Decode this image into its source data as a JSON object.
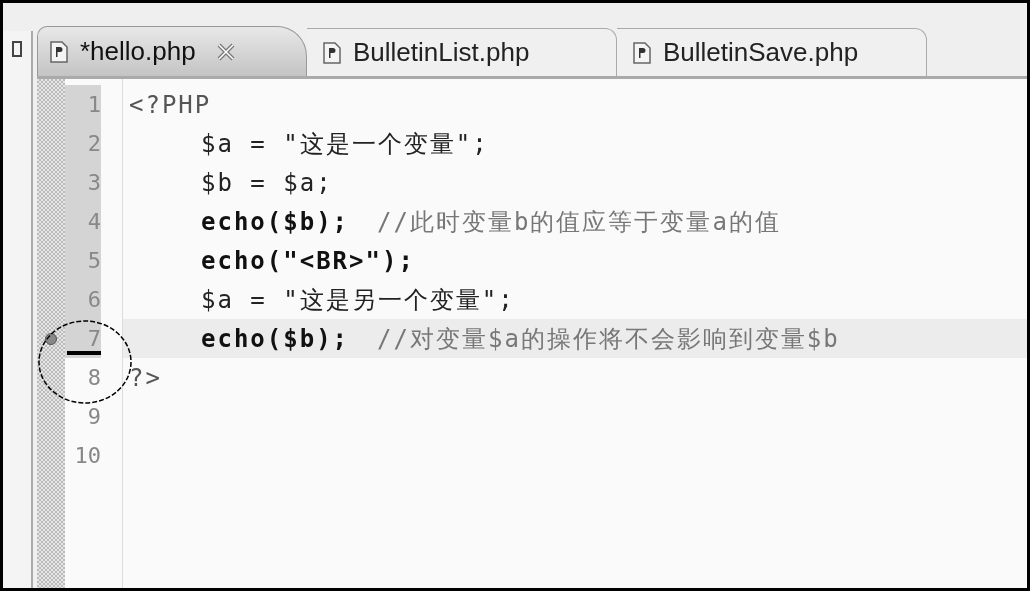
{
  "tabs": [
    {
      "label": "*hello.php",
      "selected": true
    },
    {
      "label": "BulletinList.php",
      "selected": false
    },
    {
      "label": "BulletinSave.php",
      "selected": false
    }
  ],
  "lines": [
    {
      "number": "1",
      "indented": false,
      "changed": true,
      "current": false,
      "marker": false,
      "segments": [
        {
          "kind": "tag",
          "text": "<?PHP"
        }
      ]
    },
    {
      "number": "2",
      "indented": true,
      "changed": true,
      "current": false,
      "marker": false,
      "segments": [
        {
          "kind": "plain",
          "text": "$a = \"这是一个变量\";"
        }
      ]
    },
    {
      "number": "3",
      "indented": true,
      "changed": true,
      "current": false,
      "marker": false,
      "segments": [
        {
          "kind": "plain",
          "text": "$b = $a;"
        }
      ]
    },
    {
      "number": "4",
      "indented": true,
      "changed": true,
      "current": false,
      "marker": false,
      "segments": [
        {
          "kind": "keyword",
          "text": "echo($b);"
        },
        {
          "kind": "comment",
          "text": "//此时变量b的值应等于变量a的值"
        }
      ]
    },
    {
      "number": "5",
      "indented": true,
      "changed": true,
      "current": false,
      "marker": false,
      "segments": [
        {
          "kind": "keyword",
          "text": "echo(\"<BR>\");"
        }
      ]
    },
    {
      "number": "6",
      "indented": true,
      "changed": true,
      "current": false,
      "marker": false,
      "segments": [
        {
          "kind": "plain",
          "text": "$a = \"这是另一个变量\";"
        }
      ]
    },
    {
      "number": "7",
      "indented": true,
      "changed": true,
      "current": true,
      "marker": true,
      "segments": [
        {
          "kind": "keyword",
          "text": "echo($b);"
        },
        {
          "kind": "comment",
          "text": "//对变量$a的操作将不会影响到变量$b"
        }
      ]
    },
    {
      "number": "8",
      "indented": false,
      "changed": false,
      "current": false,
      "marker": false,
      "segments": [
        {
          "kind": "tag",
          "text": "?>"
        }
      ]
    },
    {
      "number": "9",
      "changed": false,
      "current": false,
      "marker": false
    },
    {
      "number": "10",
      "changed": false,
      "current": false,
      "marker": false
    }
  ]
}
